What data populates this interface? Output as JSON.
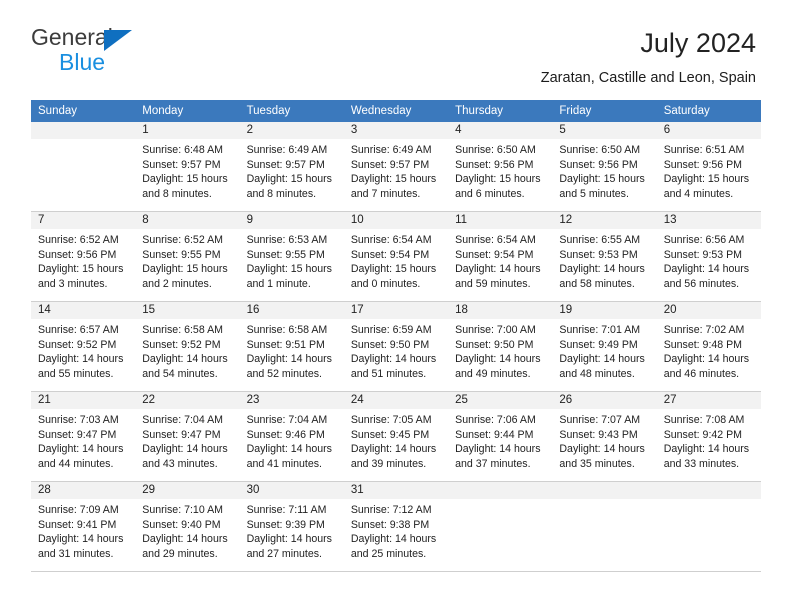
{
  "brand": {
    "name_top": "General",
    "name_bottom": "Blue",
    "triangle_color": "#0f6fc0",
    "blue_text_color": "#1a8fe0"
  },
  "header": {
    "title": "July 2024",
    "subtitle": "Zaratan, Castille and Leon, Spain"
  },
  "theme": {
    "header_bg": "#3b79bd",
    "header_text": "#ffffff",
    "daynum_bg": "#f2f2f2",
    "grid_line": "#cfcfcf"
  },
  "weekday_headers": [
    "Sunday",
    "Monday",
    "Tuesday",
    "Wednesday",
    "Thursday",
    "Friday",
    "Saturday"
  ],
  "weeks": [
    [
      {
        "day": "",
        "sunrise": "",
        "sunset": "",
        "daylight_1": "",
        "daylight_2": ""
      },
      {
        "day": "1",
        "sunrise": "Sunrise: 6:48 AM",
        "sunset": "Sunset: 9:57 PM",
        "daylight_1": "Daylight: 15 hours",
        "daylight_2": "and 8 minutes."
      },
      {
        "day": "2",
        "sunrise": "Sunrise: 6:49 AM",
        "sunset": "Sunset: 9:57 PM",
        "daylight_1": "Daylight: 15 hours",
        "daylight_2": "and 8 minutes."
      },
      {
        "day": "3",
        "sunrise": "Sunrise: 6:49 AM",
        "sunset": "Sunset: 9:57 PM",
        "daylight_1": "Daylight: 15 hours",
        "daylight_2": "and 7 minutes."
      },
      {
        "day": "4",
        "sunrise": "Sunrise: 6:50 AM",
        "sunset": "Sunset: 9:56 PM",
        "daylight_1": "Daylight: 15 hours",
        "daylight_2": "and 6 minutes."
      },
      {
        "day": "5",
        "sunrise": "Sunrise: 6:50 AM",
        "sunset": "Sunset: 9:56 PM",
        "daylight_1": "Daylight: 15 hours",
        "daylight_2": "and 5 minutes."
      },
      {
        "day": "6",
        "sunrise": "Sunrise: 6:51 AM",
        "sunset": "Sunset: 9:56 PM",
        "daylight_1": "Daylight: 15 hours",
        "daylight_2": "and 4 minutes."
      }
    ],
    [
      {
        "day": "7",
        "sunrise": "Sunrise: 6:52 AM",
        "sunset": "Sunset: 9:56 PM",
        "daylight_1": "Daylight: 15 hours",
        "daylight_2": "and 3 minutes."
      },
      {
        "day": "8",
        "sunrise": "Sunrise: 6:52 AM",
        "sunset": "Sunset: 9:55 PM",
        "daylight_1": "Daylight: 15 hours",
        "daylight_2": "and 2 minutes."
      },
      {
        "day": "9",
        "sunrise": "Sunrise: 6:53 AM",
        "sunset": "Sunset: 9:55 PM",
        "daylight_1": "Daylight: 15 hours",
        "daylight_2": "and 1 minute."
      },
      {
        "day": "10",
        "sunrise": "Sunrise: 6:54 AM",
        "sunset": "Sunset: 9:54 PM",
        "daylight_1": "Daylight: 15 hours",
        "daylight_2": "and 0 minutes."
      },
      {
        "day": "11",
        "sunrise": "Sunrise: 6:54 AM",
        "sunset": "Sunset: 9:54 PM",
        "daylight_1": "Daylight: 14 hours",
        "daylight_2": "and 59 minutes."
      },
      {
        "day": "12",
        "sunrise": "Sunrise: 6:55 AM",
        "sunset": "Sunset: 9:53 PM",
        "daylight_1": "Daylight: 14 hours",
        "daylight_2": "and 58 minutes."
      },
      {
        "day": "13",
        "sunrise": "Sunrise: 6:56 AM",
        "sunset": "Sunset: 9:53 PM",
        "daylight_1": "Daylight: 14 hours",
        "daylight_2": "and 56 minutes."
      }
    ],
    [
      {
        "day": "14",
        "sunrise": "Sunrise: 6:57 AM",
        "sunset": "Sunset: 9:52 PM",
        "daylight_1": "Daylight: 14 hours",
        "daylight_2": "and 55 minutes."
      },
      {
        "day": "15",
        "sunrise": "Sunrise: 6:58 AM",
        "sunset": "Sunset: 9:52 PM",
        "daylight_1": "Daylight: 14 hours",
        "daylight_2": "and 54 minutes."
      },
      {
        "day": "16",
        "sunrise": "Sunrise: 6:58 AM",
        "sunset": "Sunset: 9:51 PM",
        "daylight_1": "Daylight: 14 hours",
        "daylight_2": "and 52 minutes."
      },
      {
        "day": "17",
        "sunrise": "Sunrise: 6:59 AM",
        "sunset": "Sunset: 9:50 PM",
        "daylight_1": "Daylight: 14 hours",
        "daylight_2": "and 51 minutes."
      },
      {
        "day": "18",
        "sunrise": "Sunrise: 7:00 AM",
        "sunset": "Sunset: 9:50 PM",
        "daylight_1": "Daylight: 14 hours",
        "daylight_2": "and 49 minutes."
      },
      {
        "day": "19",
        "sunrise": "Sunrise: 7:01 AM",
        "sunset": "Sunset: 9:49 PM",
        "daylight_1": "Daylight: 14 hours",
        "daylight_2": "and 48 minutes."
      },
      {
        "day": "20",
        "sunrise": "Sunrise: 7:02 AM",
        "sunset": "Sunset: 9:48 PM",
        "daylight_1": "Daylight: 14 hours",
        "daylight_2": "and 46 minutes."
      }
    ],
    [
      {
        "day": "21",
        "sunrise": "Sunrise: 7:03 AM",
        "sunset": "Sunset: 9:47 PM",
        "daylight_1": "Daylight: 14 hours",
        "daylight_2": "and 44 minutes."
      },
      {
        "day": "22",
        "sunrise": "Sunrise: 7:04 AM",
        "sunset": "Sunset: 9:47 PM",
        "daylight_1": "Daylight: 14 hours",
        "daylight_2": "and 43 minutes."
      },
      {
        "day": "23",
        "sunrise": "Sunrise: 7:04 AM",
        "sunset": "Sunset: 9:46 PM",
        "daylight_1": "Daylight: 14 hours",
        "daylight_2": "and 41 minutes."
      },
      {
        "day": "24",
        "sunrise": "Sunrise: 7:05 AM",
        "sunset": "Sunset: 9:45 PM",
        "daylight_1": "Daylight: 14 hours",
        "daylight_2": "and 39 minutes."
      },
      {
        "day": "25",
        "sunrise": "Sunrise: 7:06 AM",
        "sunset": "Sunset: 9:44 PM",
        "daylight_1": "Daylight: 14 hours",
        "daylight_2": "and 37 minutes."
      },
      {
        "day": "26",
        "sunrise": "Sunrise: 7:07 AM",
        "sunset": "Sunset: 9:43 PM",
        "daylight_1": "Daylight: 14 hours",
        "daylight_2": "and 35 minutes."
      },
      {
        "day": "27",
        "sunrise": "Sunrise: 7:08 AM",
        "sunset": "Sunset: 9:42 PM",
        "daylight_1": "Daylight: 14 hours",
        "daylight_2": "and 33 minutes."
      }
    ],
    [
      {
        "day": "28",
        "sunrise": "Sunrise: 7:09 AM",
        "sunset": "Sunset: 9:41 PM",
        "daylight_1": "Daylight: 14 hours",
        "daylight_2": "and 31 minutes."
      },
      {
        "day": "29",
        "sunrise": "Sunrise: 7:10 AM",
        "sunset": "Sunset: 9:40 PM",
        "daylight_1": "Daylight: 14 hours",
        "daylight_2": "and 29 minutes."
      },
      {
        "day": "30",
        "sunrise": "Sunrise: 7:11 AM",
        "sunset": "Sunset: 9:39 PM",
        "daylight_1": "Daylight: 14 hours",
        "daylight_2": "and 27 minutes."
      },
      {
        "day": "31",
        "sunrise": "Sunrise: 7:12 AM",
        "sunset": "Sunset: 9:38 PM",
        "daylight_1": "Daylight: 14 hours",
        "daylight_2": "and 25 minutes."
      },
      {
        "day": "",
        "sunrise": "",
        "sunset": "",
        "daylight_1": "",
        "daylight_2": ""
      },
      {
        "day": "",
        "sunrise": "",
        "sunset": "",
        "daylight_1": "",
        "daylight_2": ""
      },
      {
        "day": "",
        "sunrise": "",
        "sunset": "",
        "daylight_1": "",
        "daylight_2": ""
      }
    ]
  ]
}
